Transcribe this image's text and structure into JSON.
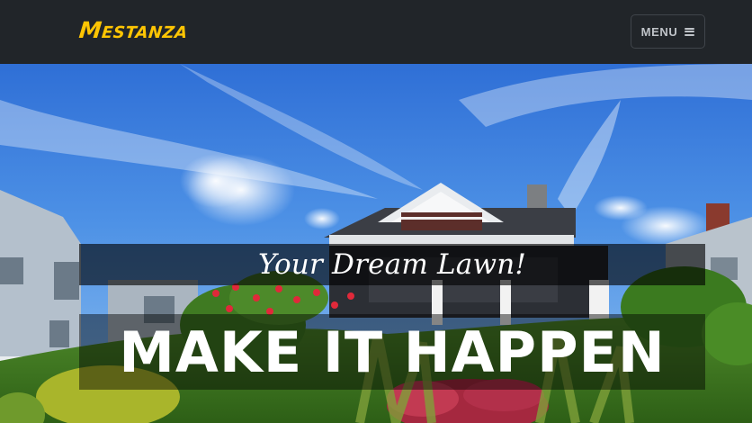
{
  "navbar": {
    "brand": "Mestanza",
    "menu_label": "MENU",
    "menu_icon": "hamburger-icon",
    "colors": {
      "background": "#212529",
      "brand": "#fec503"
    }
  },
  "hero": {
    "subheading": "Your Dream Lawn!",
    "heading": "MAKE IT HAPPEN",
    "background_image": "house-with-landscaped-garden-photo"
  }
}
